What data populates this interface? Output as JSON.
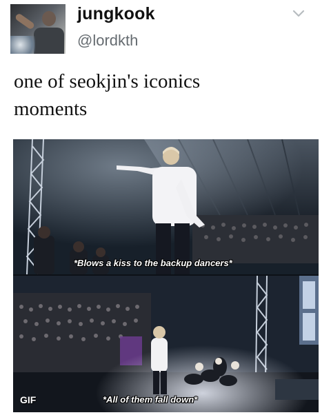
{
  "user": {
    "display_name": "jungkook",
    "handle": "@lordkth"
  },
  "icons": {
    "menu": "chevron-down-icon"
  },
  "tweet": {
    "text_line1": "one of seokjin's iconics",
    "text_line2": "moments"
  },
  "media": {
    "caption_top": "*Blows a kiss to the backup dancers*",
    "caption_bottom": "*All of them fall down*",
    "badge": "GIF"
  },
  "colors": {
    "name": "#111111",
    "handle": "#656b70",
    "background": "#ffffff"
  }
}
